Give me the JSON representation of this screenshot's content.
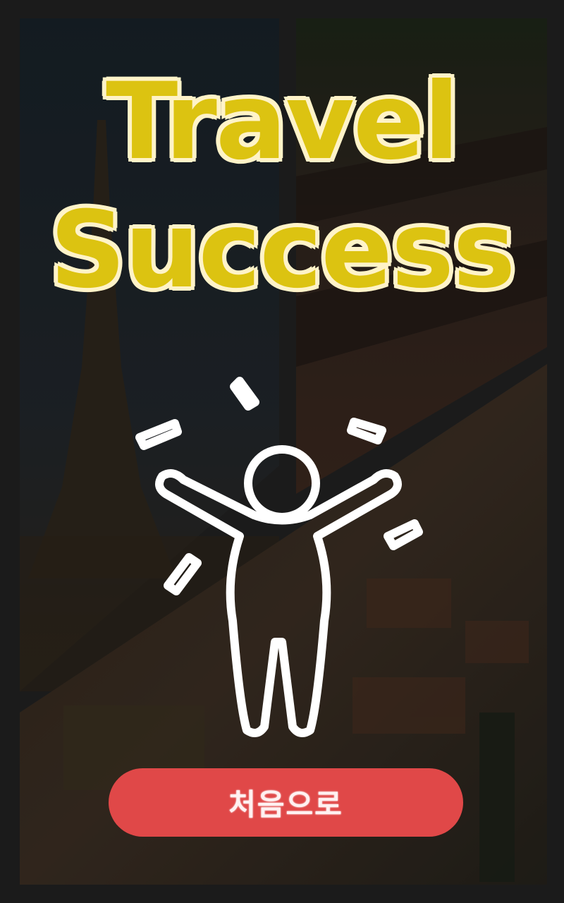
{
  "title": {
    "line1": "Travel",
    "line2": "Success"
  },
  "button": {
    "label": "처음으로"
  },
  "colors": {
    "title_fill": "#dcc311",
    "title_outline": "#fff3c8",
    "button_bg": "#e04848",
    "frame": "#2a2a2a"
  },
  "icons": {
    "figure": "celebrating-person-icon"
  }
}
